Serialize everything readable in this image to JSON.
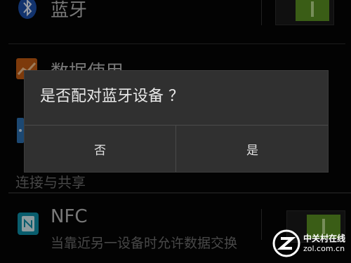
{
  "settings": {
    "bluetooth": {
      "label": "蓝牙",
      "icon": "bluetooth-icon"
    },
    "data_usage": {
      "label": "数据使用",
      "icon": "chart-icon"
    },
    "section_header": "连接与共享",
    "nfc": {
      "label": "NFC",
      "summary": "当靠近另一设备时允许数据交换",
      "icon": "nfc-icon"
    }
  },
  "dialog": {
    "title": "是否配对蓝牙设备 ？",
    "no_label": "否",
    "yes_label": "是"
  },
  "watermark": {
    "cn": "中关村在线",
    "url": "zol.com.cn"
  },
  "colors": {
    "toggle_on": "#5a8f22",
    "dialog_bg": "#303030"
  }
}
